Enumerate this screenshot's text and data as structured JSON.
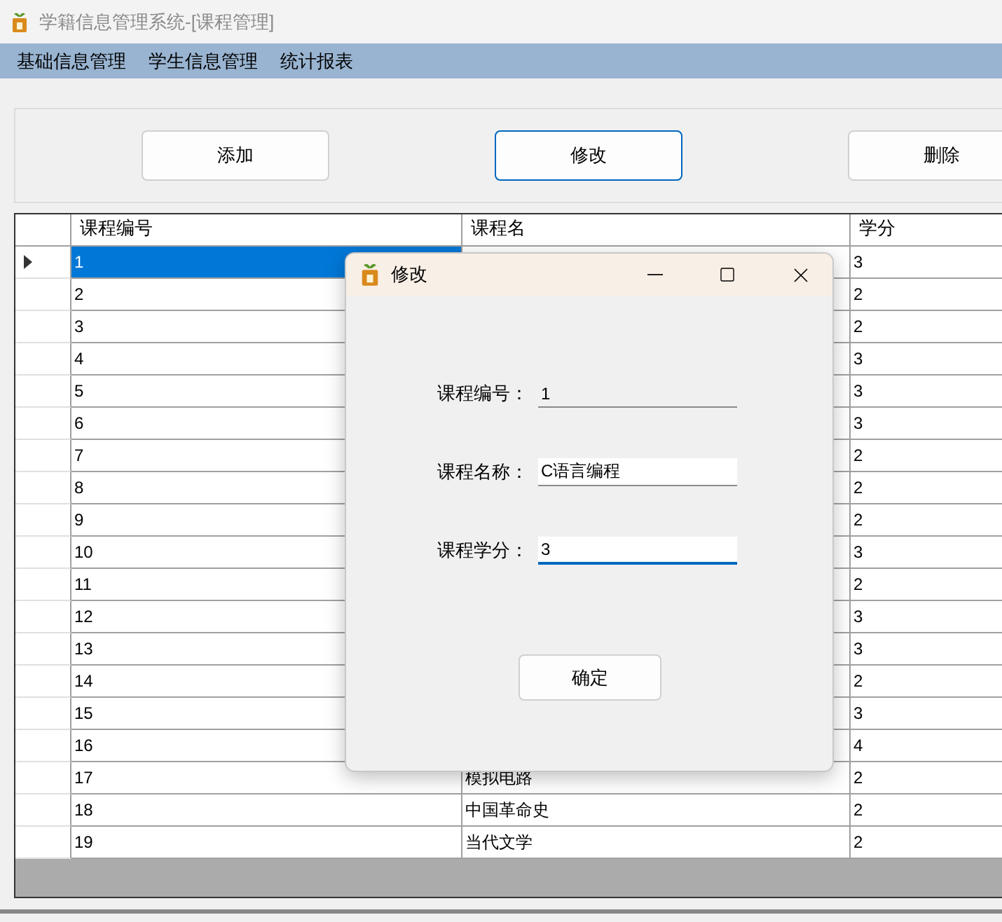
{
  "window": {
    "title": "学籍信息管理系统-[课程管理]"
  },
  "menu": [
    {
      "label": "基础信息管理"
    },
    {
      "label": "学生信息管理"
    },
    {
      "label": "统计报表"
    }
  ],
  "toolbar": [
    {
      "label": "添加",
      "focused": false
    },
    {
      "label": "修改",
      "focused": true
    },
    {
      "label": "删除",
      "focused": false
    }
  ],
  "table": {
    "columns": [
      "课程编号",
      "课程名",
      "学分"
    ],
    "rows": [
      {
        "id": "1",
        "credits": "3",
        "selected": true
      },
      {
        "id": "2",
        "credits": "2",
        "selected": false
      },
      {
        "id": "3",
        "credits": "2",
        "selected": false
      },
      {
        "id": "4",
        "credits": "3",
        "selected": false
      },
      {
        "id": "5",
        "credits": "3",
        "selected": false
      },
      {
        "id": "6",
        "credits": "3",
        "selected": false
      },
      {
        "id": "7",
        "credits": "2",
        "selected": false
      },
      {
        "id": "8",
        "credits": "2",
        "selected": false
      },
      {
        "id": "9",
        "credits": "2",
        "selected": false
      },
      {
        "id": "10",
        "credits": "3",
        "selected": false
      },
      {
        "id": "11",
        "credits": "2",
        "selected": false
      },
      {
        "id": "12",
        "credits": "3",
        "selected": false
      },
      {
        "id": "13",
        "credits": "3",
        "selected": false
      },
      {
        "id": "14",
        "credits": "2",
        "selected": false
      },
      {
        "id": "15",
        "credits": "3",
        "selected": false
      },
      {
        "id": "16",
        "credits": "4",
        "selected": false
      },
      {
        "id": "17",
        "name": "模拟电路",
        "credits": "2",
        "selected": false
      },
      {
        "id": "18",
        "name": "中国革命史",
        "credits": "2",
        "selected": false
      },
      {
        "id": "19",
        "name": "当代文学",
        "credits": "2",
        "selected": false
      }
    ]
  },
  "dialog": {
    "title": "修改",
    "fields": [
      {
        "label": "课程编号：",
        "value": "1",
        "disabled": true,
        "focused": false
      },
      {
        "label": "课程名称：",
        "value": "C语言编程",
        "disabled": false,
        "focused": false
      },
      {
        "label": "课程学分：",
        "value": "3",
        "disabled": false,
        "focused": true
      }
    ],
    "button": "确定"
  }
}
